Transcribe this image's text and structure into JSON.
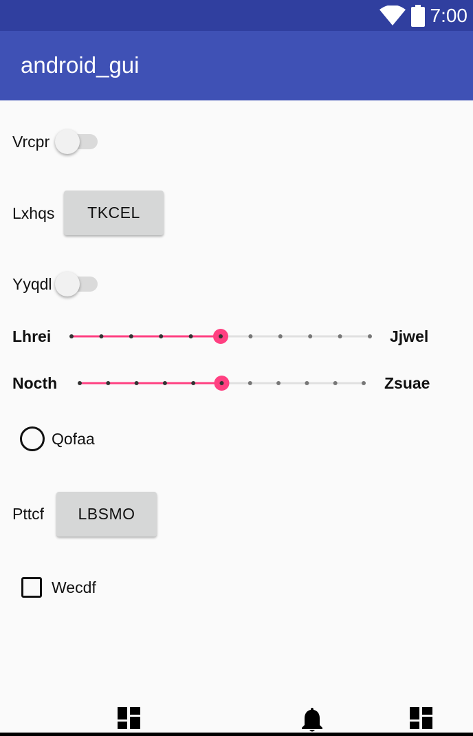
{
  "status_bar": {
    "time": "7:00",
    "icons": [
      "wifi-icon",
      "battery-icon"
    ]
  },
  "app_bar": {
    "title": "android_gui",
    "color": "#3f51b5",
    "status_color": "#303f9f"
  },
  "rows": {
    "switch1": {
      "label": "Vrcpr",
      "checked": false
    },
    "button1": {
      "label": "Lxhqs",
      "button_text": "TKCEL"
    },
    "switch2": {
      "label": "Yyqdl",
      "checked": false
    },
    "slider1": {
      "left_label": "Lhrei",
      "right_label": "Jjwel",
      "steps": 10,
      "value": 5
    },
    "slider2": {
      "left_label": "Nocth",
      "right_label": "Zsuae",
      "steps": 10,
      "value": 5
    },
    "radio": {
      "label": "Qofaa",
      "checked": false
    },
    "button2": {
      "label": "Pttcf",
      "button_text": "LBSMO"
    },
    "checkbox": {
      "label": "Wecdf",
      "checked": false
    }
  },
  "accent_color": "#ff4081",
  "bottom_nav": {
    "icons": [
      "dashboard-icon",
      "notifications-icon",
      "dashboard-icon"
    ]
  }
}
